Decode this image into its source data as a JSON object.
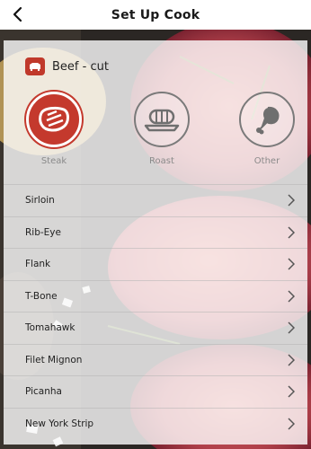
{
  "header": {
    "title": "Set Up Cook"
  },
  "card": {
    "title": "Beef - cut"
  },
  "options": [
    {
      "label": "Steak",
      "selected": true
    },
    {
      "label": "Roast",
      "selected": false
    },
    {
      "label": "Other",
      "selected": false
    }
  ],
  "cuts": [
    "Sirloin",
    "Rib-Eye",
    "Flank",
    "T-Bone",
    "Tomahawk",
    "Filet Mignon",
    "Picanha",
    "New York Strip"
  ],
  "colors": {
    "accent": "#c4392d",
    "neutral": "#7a7a7a"
  }
}
